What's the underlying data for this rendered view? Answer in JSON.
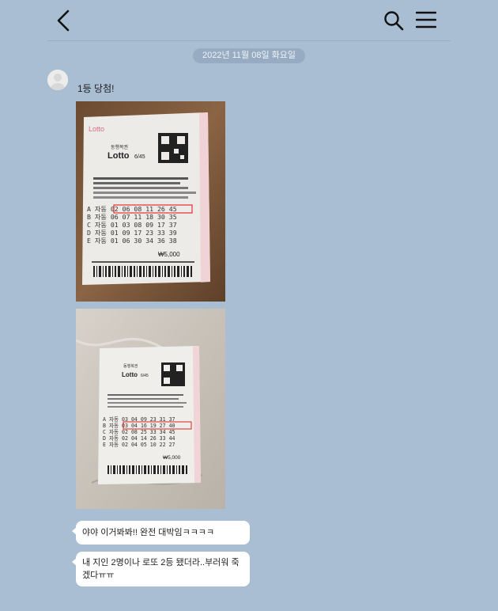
{
  "header": {
    "back_icon": "chevron-left-icon",
    "search_icon": "search-icon",
    "menu_icon": "hamburger-menu-icon"
  },
  "chat": {
    "date": "2022년 11월 08일 화요일",
    "messages": [
      {
        "type": "text",
        "text": "1등 당첨!"
      },
      {
        "type": "image",
        "alt": "lotto-ticket-photo"
      },
      {
        "type": "image",
        "alt": "lotto-ticket-photo"
      },
      {
        "type": "text",
        "text": "야야 이거봐봐!! 완전 대박임ㅋㅋㅋㅋ"
      },
      {
        "type": "text",
        "text": "내 지인 2명이나 로또 2등 됐더라..부러워 죽겠다ㅠㅠ"
      }
    ]
  },
  "ticket": {
    "brand": "Lotto",
    "sub_brand": "6/45",
    "issuer": "동행복권",
    "amount": "₩5,000",
    "rows1": [
      "A 자동 02 06 08 11 26 45",
      "B 자동 06 07 11 18 30 35",
      "C 자동 01 03 08 09 17 37",
      "D 자동 01 09 17 23 33 39",
      "E 자동 01 06 30 34 36 38"
    ],
    "rows2": [
      "A 자동 03 04 09 23 31 37",
      "B 자동 03 04 16 19 27 40",
      "C 자동 02 08 25 33 34 45",
      "D 자동 02 04 14 26 33 44",
      "E 자동 02 04 05 10 22 27"
    ]
  },
  "colors": {
    "background": "#a9bed3",
    "bubble": "#ffffff",
    "date_pill": "#97acc2"
  }
}
